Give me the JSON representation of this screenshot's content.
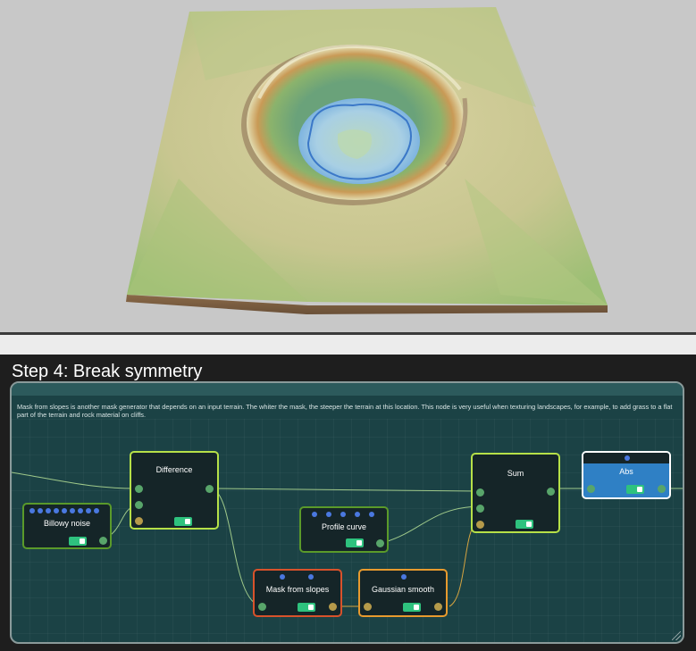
{
  "step": {
    "title": "Step 4: Break symmetry"
  },
  "description": "Mask from slopes is another mask generator that depends on an input terrain. The whiter the mask, the steeper the terrain at this location. This node is very useful when texturing landscapes, for example, to add grass to a flat part of the terrain and rock material on cliffs.",
  "nodes": {
    "billowy": {
      "title": "Billowy noise",
      "border": "#5a9a2a"
    },
    "difference": {
      "title": "Difference",
      "border": "#b6e048"
    },
    "profile": {
      "title": "Profile curve",
      "border": "#5a9a2a"
    },
    "sum": {
      "title": "Sum",
      "border": "#b6e048"
    },
    "abs": {
      "title": "Abs",
      "border": "#ffffff",
      "fill": "#2f80c5"
    },
    "mask": {
      "title": "Mask from slopes",
      "border": "#d8522b"
    },
    "gaussian": {
      "title": "Gaussian smooth",
      "border": "#e89a2e"
    }
  },
  "colors": {
    "wire": "#9fc98a",
    "wire_orange": "#d6a440",
    "frame_bg": "#1b4245"
  }
}
